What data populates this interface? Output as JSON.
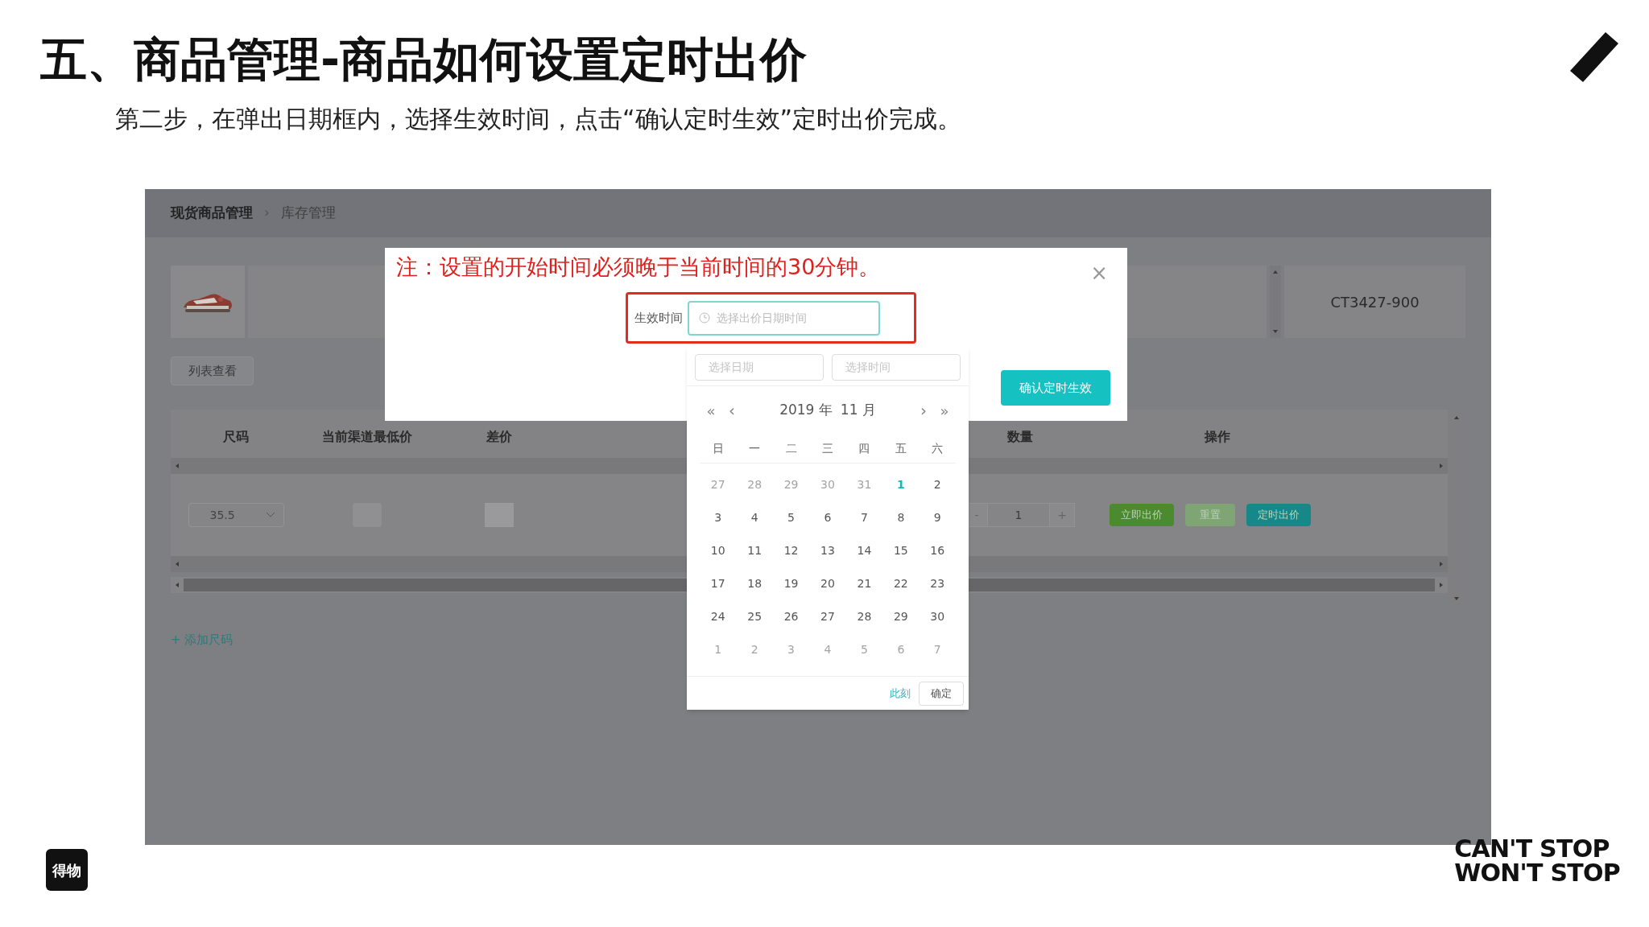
{
  "slide": {
    "title": "五、商品管理-商品如何设置定时出价",
    "subtitle": "第二步，在弹出日期框内，选择生效时间，点击“确认定时生效”定时出价完成。",
    "logo": "得物",
    "slogan": [
      "CAN'T STOP",
      "WON'T STOP"
    ]
  },
  "app": {
    "breadcrumb": [
      "现货商品管理",
      "库存管理"
    ],
    "breadcrumb_separator": "›",
    "sku": "CT3427-900",
    "list_button": "列表查看",
    "columns": [
      "尺码",
      "当前渠道最低价",
      "差价",
      "数量",
      "操作"
    ],
    "row": {
      "size": "35.5",
      "minus": "-",
      "quantity": "1",
      "plus": "+",
      "actions": [
        {
          "label": "立即出价",
          "color": "#4b8a2e"
        },
        {
          "label": "重置",
          "color": "#7fa575"
        },
        {
          "label": "定时出价",
          "color": "#17888a"
        }
      ]
    },
    "add_size": "+ 添加尺码"
  },
  "modal": {
    "note": "注：设置的开始时间必须晚于当前时间的30分钟。",
    "close": "×",
    "field_label": "生效时间",
    "placeholder": "选择出价日期时间",
    "confirm": "确认定时生效"
  },
  "calendar": {
    "date_placeholder": "选择日期",
    "time_placeholder": "选择时间",
    "prev_year": "«",
    "prev_month": "‹",
    "year": "2019 年",
    "month": "11 月",
    "next_month": "›",
    "next_year": "»",
    "weekdays": [
      "日",
      "一",
      "二",
      "三",
      "四",
      "五",
      "六"
    ],
    "weeks": [
      [
        {
          "day": "27",
          "muted": true,
          "today": false
        },
        {
          "day": "28",
          "muted": true,
          "today": false
        },
        {
          "day": "29",
          "muted": true,
          "today": false
        },
        {
          "day": "30",
          "muted": true,
          "today": false
        },
        {
          "day": "31",
          "muted": true,
          "today": false
        },
        {
          "day": "1",
          "muted": false,
          "today": true
        },
        {
          "day": "2",
          "muted": false,
          "today": false
        }
      ],
      [
        {
          "day": "3",
          "muted": false,
          "today": false
        },
        {
          "day": "4",
          "muted": false,
          "today": false
        },
        {
          "day": "5",
          "muted": false,
          "today": false
        },
        {
          "day": "6",
          "muted": false,
          "today": false
        },
        {
          "day": "7",
          "muted": false,
          "today": false
        },
        {
          "day": "8",
          "muted": false,
          "today": false
        },
        {
          "day": "9",
          "muted": false,
          "today": false
        }
      ],
      [
        {
          "day": "10",
          "muted": false,
          "today": false
        },
        {
          "day": "11",
          "muted": false,
          "today": false
        },
        {
          "day": "12",
          "muted": false,
          "today": false
        },
        {
          "day": "13",
          "muted": false,
          "today": false
        },
        {
          "day": "14",
          "muted": false,
          "today": false
        },
        {
          "day": "15",
          "muted": false,
          "today": false
        },
        {
          "day": "16",
          "muted": false,
          "today": false
        }
      ],
      [
        {
          "day": "17",
          "muted": false,
          "today": false
        },
        {
          "day": "18",
          "muted": false,
          "today": false
        },
        {
          "day": "19",
          "muted": false,
          "today": false
        },
        {
          "day": "20",
          "muted": false,
          "today": false
        },
        {
          "day": "21",
          "muted": false,
          "today": false
        },
        {
          "day": "22",
          "muted": false,
          "today": false
        },
        {
          "day": "23",
          "muted": false,
          "today": false
        }
      ],
      [
        {
          "day": "24",
          "muted": false,
          "today": false
        },
        {
          "day": "25",
          "muted": false,
          "today": false
        },
        {
          "day": "26",
          "muted": false,
          "today": false
        },
        {
          "day": "27",
          "muted": false,
          "today": false
        },
        {
          "day": "28",
          "muted": false,
          "today": false
        },
        {
          "day": "29",
          "muted": false,
          "today": false
        },
        {
          "day": "30",
          "muted": false,
          "today": false
        }
      ],
      [
        {
          "day": "1",
          "muted": true,
          "today": false
        },
        {
          "day": "2",
          "muted": true,
          "today": false
        },
        {
          "day": "3",
          "muted": true,
          "today": false
        },
        {
          "day": "4",
          "muted": true,
          "today": false
        },
        {
          "day": "5",
          "muted": true,
          "today": false
        },
        {
          "day": "6",
          "muted": true,
          "today": false
        },
        {
          "day": "7",
          "muted": true,
          "today": false
        }
      ]
    ],
    "now": "此刻",
    "ok": "确定"
  }
}
